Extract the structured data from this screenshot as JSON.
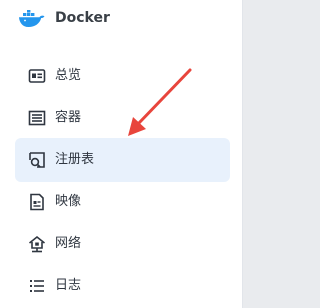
{
  "app": {
    "title": "Docker",
    "icon": "docker-whale-icon"
  },
  "sidebar": {
    "items": [
      {
        "label": "总览",
        "icon": "overview-card-icon",
        "selected": false
      },
      {
        "label": "容器",
        "icon": "container-list-icon",
        "selected": false
      },
      {
        "label": "注册表",
        "icon": "registry-search-icon",
        "selected": true
      },
      {
        "label": "映像",
        "icon": "image-file-icon",
        "selected": false
      },
      {
        "label": "网络",
        "icon": "network-house-icon",
        "selected": false
      },
      {
        "label": "日志",
        "icon": "log-list-icon",
        "selected": false
      }
    ]
  },
  "annotation": {
    "arrow_color": "#e8453c",
    "points_to": "注册表"
  },
  "colors": {
    "selected_bg": "#e8f1fc",
    "docker_blue": "#2496ed",
    "text": "#2f3640"
  }
}
